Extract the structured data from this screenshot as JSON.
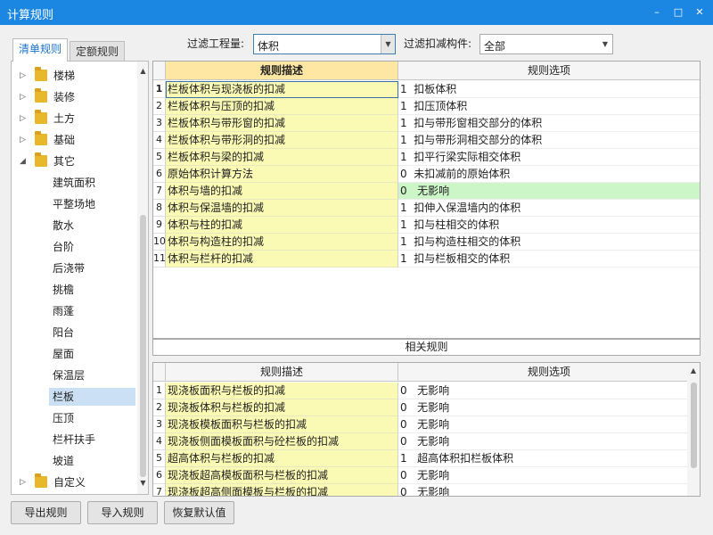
{
  "window": {
    "title": "计算规则",
    "minimize": "–",
    "maximize": "□",
    "close": "✕"
  },
  "tabs": [
    "清单规则",
    "定额规则"
  ],
  "tree": [
    {
      "label": "楼梯",
      "type": "folder",
      "expanded": false
    },
    {
      "label": "装修",
      "type": "folder",
      "expanded": false
    },
    {
      "label": "土方",
      "type": "folder",
      "expanded": false
    },
    {
      "label": "基础",
      "type": "folder",
      "expanded": false
    },
    {
      "label": "其它",
      "type": "folder",
      "expanded": true
    },
    {
      "label": "建筑面积",
      "type": "child"
    },
    {
      "label": "平整场地",
      "type": "child"
    },
    {
      "label": "散水",
      "type": "child"
    },
    {
      "label": "台阶",
      "type": "child"
    },
    {
      "label": "后浇带",
      "type": "child"
    },
    {
      "label": "挑檐",
      "type": "child"
    },
    {
      "label": "雨蓬",
      "type": "child"
    },
    {
      "label": "阳台",
      "type": "child"
    },
    {
      "label": "屋面",
      "type": "child"
    },
    {
      "label": "保温层",
      "type": "child"
    },
    {
      "label": "栏板",
      "type": "child",
      "selected": true
    },
    {
      "label": "压顶",
      "type": "child"
    },
    {
      "label": "栏杆扶手",
      "type": "child"
    },
    {
      "label": "坡道",
      "type": "child"
    },
    {
      "label": "自定义",
      "type": "folder",
      "expanded": false
    }
  ],
  "filters": {
    "quantity_label": "过滤工程量:",
    "quantity_value": "体积",
    "component_label": "过滤扣减构件:",
    "component_value": "全部"
  },
  "rules_table": {
    "headers": [
      "规则描述",
      "规则选项"
    ],
    "rows": [
      {
        "no": "1",
        "desc": "栏板体积与现浇板的扣减",
        "option": "1  扣板体积"
      },
      {
        "no": "2",
        "desc": "栏板体积与压顶的扣减",
        "option": "1  扣压顶体积"
      },
      {
        "no": "3",
        "desc": "栏板体积与带形窗的扣减",
        "option": "1  扣与带形窗相交部分的体积"
      },
      {
        "no": "4",
        "desc": "栏板体积与带形洞的扣减",
        "option": "1  扣与带形洞相交部分的体积"
      },
      {
        "no": "5",
        "desc": "栏板体积与梁的扣减",
        "option": "1  扣平行梁实际相交体积"
      },
      {
        "no": "6",
        "desc": "原始体积计算方法",
        "option": "0  未扣减前的原始体积"
      },
      {
        "no": "7",
        "desc": "体积与墙的扣减",
        "option": "0   无影响"
      },
      {
        "no": "8",
        "desc": "体积与保温墙的扣减",
        "option": "1  扣伸入保温墙内的体积"
      },
      {
        "no": "9",
        "desc": "体积与柱的扣减",
        "option": "1  扣与柱相交的体积"
      },
      {
        "no": "10",
        "desc": "体积与构造柱的扣减",
        "option": "1  扣与构造柱相交的体积"
      },
      {
        "no": "11",
        "desc": "体积与栏杆的扣减",
        "option": "1  扣与栏板相交的体积"
      }
    ]
  },
  "related_title": "相关规则",
  "related_table": {
    "headers": [
      "规则描述",
      "规则选项"
    ],
    "rows": [
      {
        "no": "1",
        "desc": "现浇板面积与栏板的扣减",
        "option": "0   无影响"
      },
      {
        "no": "2",
        "desc": "现浇板体积与栏板的扣减",
        "option": "0   无影响"
      },
      {
        "no": "3",
        "desc": "现浇板模板面积与栏板的扣减",
        "option": "0   无影响"
      },
      {
        "no": "4",
        "desc": "现浇板侧面模板面积与砼栏板的扣减",
        "option": "0   无影响"
      },
      {
        "no": "5",
        "desc": "超高体积与栏板的扣减",
        "option": "1   超高体积扣栏板体积"
      },
      {
        "no": "6",
        "desc": "现浇板超高模板面积与栏板的扣减",
        "option": "0   无影响"
      },
      {
        "no": "7",
        "desc": "现浇板超高侧面模板与栏板的扣减",
        "option": "0   无影响"
      }
    ]
  },
  "buttons": {
    "export": "导出规则",
    "import": "导入规则",
    "restore": "恢复默认值"
  }
}
